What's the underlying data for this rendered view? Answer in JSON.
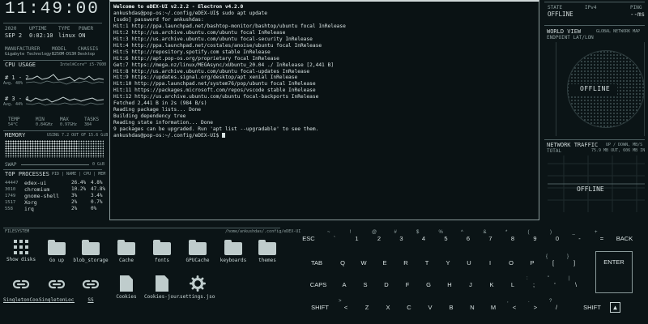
{
  "clock": "11:49:00",
  "sysinfo": {
    "labels": [
      "2020",
      "UPTIME",
      "TYPE",
      "POWER"
    ],
    "values": [
      "SEP 2",
      "0:02:10",
      "linux",
      "ON"
    ]
  },
  "hw": {
    "labels": [
      "MANUFACTURER",
      "MODEL",
      "CHASSIS"
    ],
    "values": [
      "Gigabyte Technology",
      "B250M-DS3H",
      "Desktop"
    ]
  },
  "cpu": {
    "title": "CPU USAGE",
    "model": "Intel®Core™ i5-7600",
    "group1": "# 1 - 2",
    "avg1": "Avg. 40%",
    "group2": "# 3 - 4",
    "avg2": "Avg. 44%",
    "stats_labels": [
      "TEMP",
      "MIN",
      "MAX",
      "TASKS"
    ],
    "stats_values": [
      "54°C",
      "0.84GHz",
      "0.97GHz",
      "384"
    ]
  },
  "memory": {
    "title": "MEMORY",
    "usage": "USING 7.2 OUT OF 15.6 GiB",
    "swap_label": "SWAP",
    "swap_value": "0 GiB"
  },
  "processes": {
    "title": "TOP PROCESSES",
    "header": "PID | NAME | CPU | MEM",
    "rows": [
      {
        "pid": "44447",
        "name": "edex-ui",
        "cpu": "26.4%",
        "mem": "4.8%"
      },
      {
        "pid": "3010",
        "name": "chromium",
        "cpu": "10.2%",
        "mem": "47.8%"
      },
      {
        "pid": "1749",
        "name": "gnome-shell",
        "cpu": "3%",
        "mem": "3.4%"
      },
      {
        "pid": "1517",
        "name": "Xorg",
        "cpu": "2%",
        "mem": "0.7%"
      },
      {
        "pid": "558",
        "name": "irq",
        "cpu": "2%",
        "mem": "0%"
      }
    ]
  },
  "terminal": {
    "lines": [
      "Welcome to eDEX-UI v2.2.2 - Electron v4.2.0",
      "ankushdas@pop-os:~/.config/eDEX-UI$ sudo apt update",
      "[sudo] password for ankushdas:",
      "Hit:1 http://ppa.launchpad.net/bashtop-monitor/bashtop/ubuntu focal InRelease",
      "Hit:2 http://us.archive.ubuntu.com/ubuntu focal InRelease",
      "Hit:3 http://us.archive.ubuntu.com/ubuntu focal-security InRelease",
      "Hit:4 http://ppa.launchpad.net/costales/anoise/ubuntu focal InRelease",
      "Hit:5 http://repository.spotify.com stable InRelease",
      "Hit:6 http://apt.pop-os.org/proprietary focal InRelease",
      "Get:7 https://mega.nz/linux/MEGAsync/xUbuntu_20.04 ./ InRelease [2,441 B]",
      "Hit:8 http://us.archive.ubuntu.com/ubuntu focal-updates InRelease",
      "Hit:9 https://updates.signal.org/desktop/apt xenial InRelease",
      "Hit:10 http://ppa.launchpad.net/system76/pop/ubuntu focal InRelease",
      "Hit:11 https://packages.microsoft.com/repos/vscode stable InRelease",
      "Hit:12 http://us.archive.ubuntu.com/ubuntu focal-backports InRelease",
      "Fetched 2,441 B in 2s (984 B/s)",
      "Reading package lists... Done",
      "Building dependency tree",
      "Reading state information... Done",
      "9 packages can be upgraded. Run 'apt list --upgradable' to see them.",
      "ankushdas@pop-os:~/.config/eDEX-UI$ "
    ]
  },
  "network": {
    "state_label": "STATE",
    "state_value": "OFFLINE",
    "ipv_label": "IPv4",
    "ipv_value": "",
    "ping_label": "PING",
    "ping_value": "--ms",
    "worldview_title": "WORLD VIEW",
    "worldview_sub": "GLOBAL NETWORK MAP",
    "endpoint": "ENDPOINT LAT/LON",
    "offline1": "OFFLINE",
    "traffic_title": "NETWORK TRAFFIC",
    "traffic_sub": "UP / DOWN, MB/S",
    "total_label": "TOTAL",
    "total_value": "75.9 MB OUT, 606 MB IN",
    "offline2": "OFFLINE"
  },
  "filesystem": {
    "title": "FILESYSTEM",
    "path": "/home/ankushdas/.config/eDEX-UI",
    "items": [
      {
        "name": "Show disks",
        "icon": "grid-icon"
      },
      {
        "name": "Go up",
        "icon": "folder-icon"
      },
      {
        "name": "blob_storage",
        "icon": "folder-icon"
      },
      {
        "name": "Cache",
        "icon": "folder-icon"
      },
      {
        "name": "fonts",
        "icon": "folder-icon"
      },
      {
        "name": "GPUCache",
        "icon": "folder-icon"
      },
      {
        "name": "keyboards",
        "icon": "folder-icon"
      },
      {
        "name": "themes",
        "icon": "folder-icon"
      },
      {
        "name": "SingletonCoo…",
        "icon": "link-icon"
      },
      {
        "name": "SingletonLock",
        "icon": "link-icon"
      },
      {
        "name": "SS",
        "icon": "link-icon"
      },
      {
        "name": "Cookies",
        "icon": "file-icon"
      },
      {
        "name": "Cookies-jour…",
        "icon": "file-icon"
      },
      {
        "name": "settings.json",
        "icon": "gear-icon"
      }
    ]
  },
  "keyboard": {
    "row1": [
      {
        "main": "ESC"
      },
      {
        "main": "`",
        "shift": "~"
      },
      {
        "main": "1",
        "shift": "!"
      },
      {
        "main": "2",
        "shift": "@"
      },
      {
        "main": "3",
        "shift": "#"
      },
      {
        "main": "4",
        "shift": "$"
      },
      {
        "main": "5",
        "shift": "%"
      },
      {
        "main": "6",
        "shift": "^"
      },
      {
        "main": "7",
        "shift": "&"
      },
      {
        "main": "8",
        "shift": "*"
      },
      {
        "main": "9",
        "shift": "("
      },
      {
        "main": "0",
        "shift": ")"
      },
      {
        "main": "-",
        "shift": "_"
      },
      {
        "main": "=",
        "shift": "+"
      },
      {
        "main": "BACK"
      }
    ],
    "row2": [
      {
        "main": "TAB"
      },
      {
        "main": "Q"
      },
      {
        "main": "W"
      },
      {
        "main": "E"
      },
      {
        "main": "R"
      },
      {
        "main": "T"
      },
      {
        "main": "Y"
      },
      {
        "main": "U"
      },
      {
        "main": "I"
      },
      {
        "main": "O"
      },
      {
        "main": "P"
      },
      {
        "main": "[",
        "shift": "{"
      },
      {
        "main": "]",
        "shift": "}"
      },
      {
        "main": "ENTER"
      }
    ],
    "row3": [
      {
        "main": "CAPS"
      },
      {
        "main": "A"
      },
      {
        "main": "S"
      },
      {
        "main": "D"
      },
      {
        "main": "F"
      },
      {
        "main": "G"
      },
      {
        "main": "H"
      },
      {
        "main": "J"
      },
      {
        "main": "K"
      },
      {
        "main": "L"
      },
      {
        "main": ";",
        "shift": ":"
      },
      {
        "main": "'",
        "shift": "\""
      },
      {
        "main": "\\",
        "shift": "|"
      }
    ],
    "row4": [
      {
        "main": "SHIFT"
      },
      {
        "main": "<",
        "shift": ">"
      },
      {
        "main": "Z"
      },
      {
        "main": "X"
      },
      {
        "main": "C"
      },
      {
        "main": "V"
      },
      {
        "main": "B"
      },
      {
        "main": "N"
      },
      {
        "main": "M"
      },
      {
        "main": "<",
        "shift": ","
      },
      {
        "main": ">",
        "shift": "."
      },
      {
        "main": "/",
        "shift": "?"
      },
      {
        "main": "SHIFT"
      }
    ]
  }
}
